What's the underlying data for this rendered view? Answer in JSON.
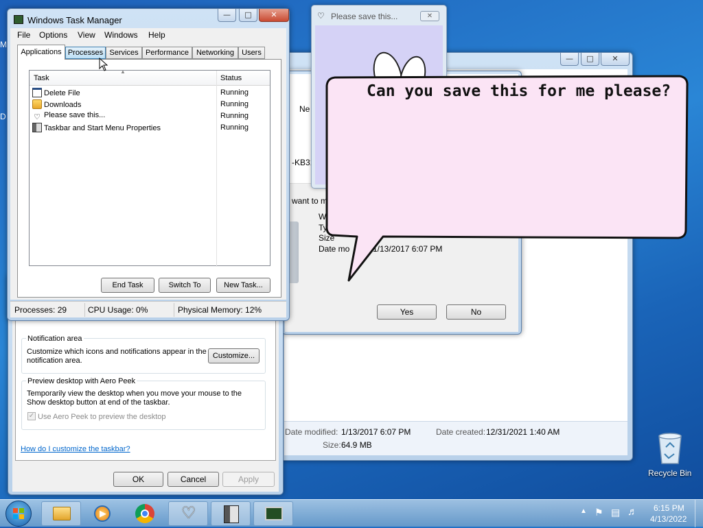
{
  "desktop": {
    "recycle_bin_label": "Recycle Bin",
    "left_edge_glyphs": [
      "M",
      "D"
    ]
  },
  "task_manager": {
    "title": "Windows Task Manager",
    "menu": [
      "File",
      "Options",
      "View",
      "Windows",
      "Help"
    ],
    "tabs": [
      "Applications",
      "Processes",
      "Services",
      "Performance",
      "Networking",
      "Users"
    ],
    "columns": {
      "task": "Task",
      "status": "Status"
    },
    "rows": [
      {
        "task": "Delete File",
        "status": "Running",
        "icon": "window-icon"
      },
      {
        "task": "Downloads",
        "status": "Running",
        "icon": "folder-icon"
      },
      {
        "task": "Please save this...",
        "status": "Running",
        "icon": "bunny-icon"
      },
      {
        "task": "Taskbar and Start Menu Properties",
        "status": "Running",
        "icon": "taskbar-properties-icon"
      }
    ],
    "buttons": {
      "end_task": "End Task",
      "switch_to": "Switch To",
      "new_task": "New Task..."
    },
    "statusbar": {
      "processes": "Processes: 29",
      "cpu": "CPU Usage: 0%",
      "memory": "Physical Memory: 12%"
    }
  },
  "taskbar_properties": {
    "notification_title": "Notification area",
    "notification_text": "Customize which icons and notifications appear in the notification area.",
    "customize_button": "Customize...",
    "aero_title": "Preview desktop with Aero Peek",
    "aero_text": "Temporarily view the desktop when you move your mouse to the Show desktop button at end of the taskbar.",
    "aero_checkbox": "Use Aero Peek to preview the desktop",
    "help_link": "How do I customize the taskbar?",
    "ok": "OK",
    "cancel": "Cancel",
    "apply": "Apply"
  },
  "delete_dialog": {
    "tab_fragment": "Ne",
    "file_fragment": "-KB31",
    "question_fragment": "want to m",
    "info_fragments": [
      "W",
      "Ty",
      "Size",
      "Date mo"
    ],
    "date_value": "1/13/2017 6:07 PM",
    "yes": "Yes",
    "no": "No"
  },
  "downloads_details": {
    "date_modified_label": "Date modified:",
    "date_modified_value": "1/13/2017 6:07 PM",
    "date_created_label": "Date created:",
    "date_created_value": "12/31/2021 1:40 AM",
    "size_label": "Size:",
    "size_value": "64.9 MB"
  },
  "bunny_window": {
    "title": "Please save this...",
    "speech": "Can you save this for me please?"
  },
  "taskbar": {
    "time": "6:15 PM",
    "date": "4/13/2022",
    "pinned": [
      "explorer-icon",
      "media-player-icon",
      "chrome-icon",
      "bunny-app-icon",
      "taskbar-properties-app-icon",
      "task-manager-app-icon"
    ]
  },
  "colors": {
    "selected_tab_blue": "#3c7fb1",
    "speech_fill": "#fbe4f5",
    "link": "#0066cc"
  }
}
